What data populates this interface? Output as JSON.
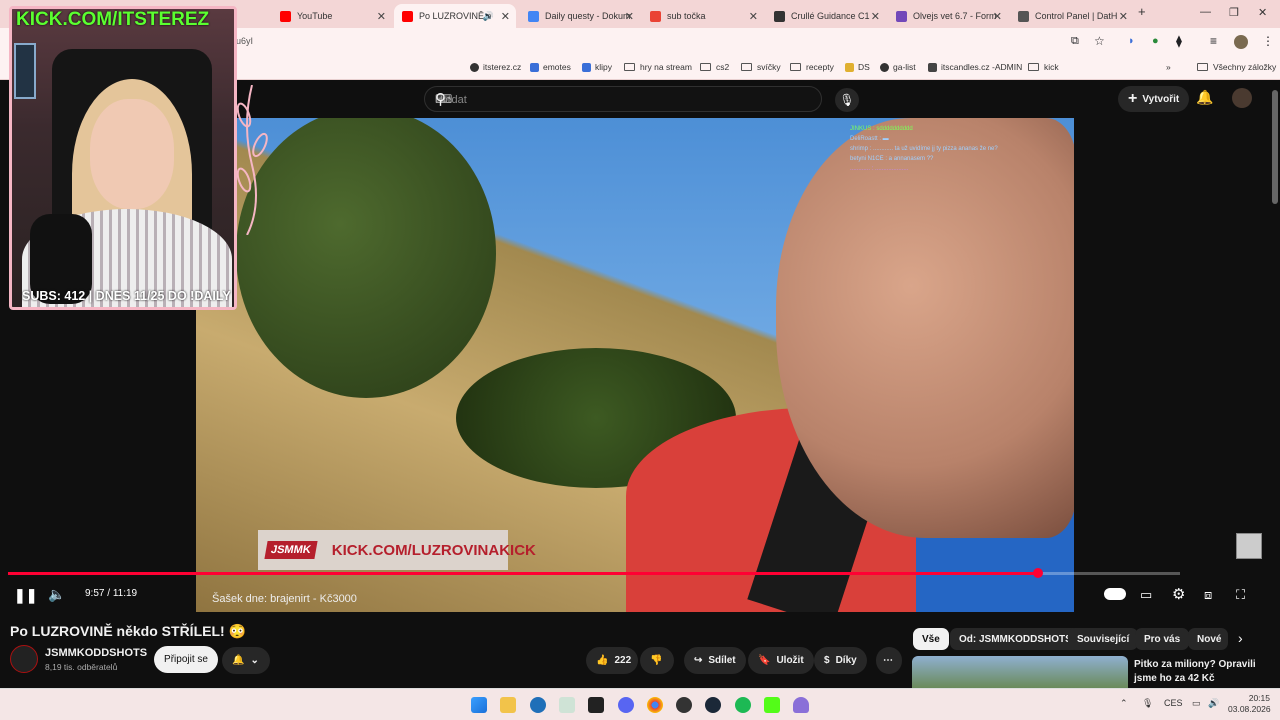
{
  "browser": {
    "tabs": [
      {
        "label": "YouTube",
        "color": "#ff0000"
      },
      {
        "label": "Po LUZROVINĚ n",
        "color": "#ff0000",
        "active": true
      },
      {
        "label": "Daily questy - Dokum",
        "color": "#4285f4"
      },
      {
        "label": "sub točka",
        "color": "#ea4335"
      },
      {
        "label": "Crullé Guidance C1",
        "color": "#333333"
      },
      {
        "label": "Olvejs vet 6.7 - Form",
        "color": "#7248b9"
      },
      {
        "label": "Control Panel | DatH",
        "color": "#555555"
      }
    ],
    "url": "u6yI",
    "bookmarks": [
      "itsterez.cz",
      "emotes",
      "klipy",
      "hry na stream",
      "cs2",
      "svíčky",
      "recepty",
      "DS",
      "ga-list",
      "itscandles.cz -ADMIN",
      "kick"
    ],
    "all_bookmarks": "Všechny záložky"
  },
  "webcam": {
    "kick_url": "KICK.COM/ITSTEREZ",
    "subs": "SUBS: 412 | DNES 11/25 DO !DAILY"
  },
  "youtube": {
    "search_placeholder": "Hledat",
    "create_label": "Vytvořit"
  },
  "video": {
    "banner_logo": "JSMMK",
    "banner_text": "KICK.COM/LUZROVINAKICK",
    "caption": "Šašek dne: brajenirt - Kč3000",
    "chat_lines": [
      "JINKUS : sdddddddddd",
      "DeliRoastt : ▬",
      "shrimp : ............ ta už uvidíme jj ty pizza ananas že ne?",
      "betyni N1CE : a annanasem ??",
      "............ : ...................."
    ],
    "current_time": "9:57",
    "duration": "11:19",
    "progress": 0.879
  },
  "meta": {
    "title": "Po LUZROVINĚ někdo STŘÍLEL! 😳",
    "channel": "JSMMKODDSHOTS",
    "subscribers": "8,19 tis. odběratelů",
    "join_label": "Připojit se",
    "likes": "222",
    "share_label": "Sdílet",
    "save_label": "Uložit",
    "thanks_label": "Díky"
  },
  "chips": [
    "Vše",
    "Od: JSMMKODDSHOTS",
    "Související",
    "Pro vás",
    "Nové"
  ],
  "recommendation": {
    "title_line1": "Pitko za miliony? Opravili",
    "title_line2": "jsme ho za 42 Kč"
  },
  "tray": {
    "lang": "CES",
    "time": "20:15",
    "date": "03.08.2026"
  }
}
